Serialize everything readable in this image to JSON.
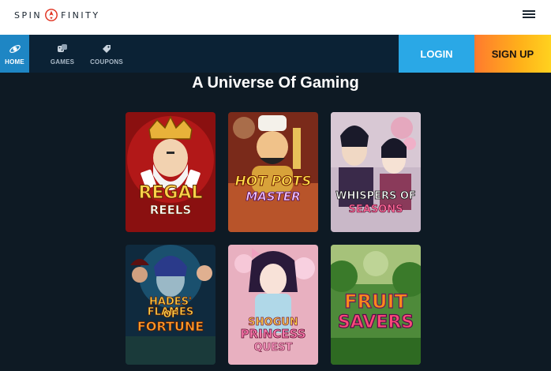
{
  "brand": {
    "logo_left": "SPIN",
    "logo_right": "FINITY"
  },
  "nav": {
    "items": [
      {
        "label": "HOME",
        "icon": "rocket-icon"
      },
      {
        "label": "GAMES",
        "icon": "dice-icon"
      },
      {
        "label": "COUPONS",
        "icon": "coupon-icon"
      }
    ],
    "active": "HOME",
    "login_label": "LOGIN",
    "signup_label": "SIGN UP",
    "menu_icon": "hamburger-icon"
  },
  "main": {
    "heading": "A Universe Of Gaming",
    "games": [
      {
        "title_line1": "REGAL",
        "title_line2": "REELS"
      },
      {
        "title_line1": "HOT POTS",
        "title_line2": "MASTER"
      },
      {
        "title_line1": "WHISPERS OF",
        "title_line2": "SEASONS"
      },
      {
        "title_line1": "HADES' FLAMES",
        "title_line2": "OF",
        "title_line3": "FORTUNE"
      },
      {
        "title_line1": "SHOGUN",
        "title_line2": "PRINCESS",
        "title_line3": "QUEST"
      },
      {
        "title_line1": "FRUIT",
        "title_line2": "SAVERS"
      }
    ]
  },
  "colors": {
    "background": "#0e1a24",
    "navbar": "#0b2235",
    "active_tab": "#1e86c4",
    "login": "#2aa8e6",
    "signup_from": "#ff7a2e",
    "signup_to": "#ffd21f"
  }
}
